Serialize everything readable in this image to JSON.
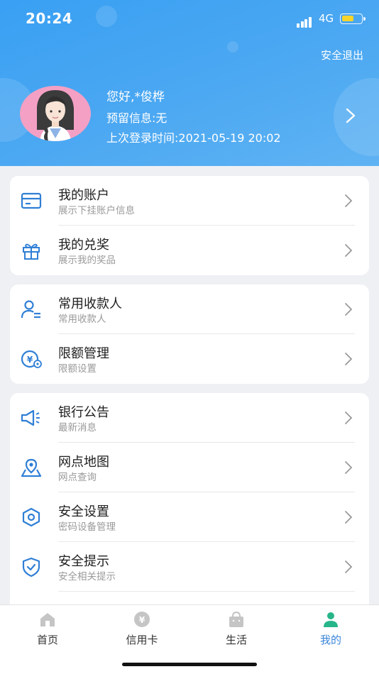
{
  "status_bar": {
    "time": "20:24",
    "network": "4G"
  },
  "header": {
    "logout": "安全退出",
    "greeting": "您好,*俊桦",
    "reserved_info": "预留信息:无",
    "last_login": "上次登录时间:2021-05-19 20:02"
  },
  "cards": [
    {
      "rows": [
        {
          "title": "我的账户",
          "sub": "展示下挂账户信息",
          "icon": "card-icon"
        },
        {
          "title": "我的兑奖",
          "sub": "展示我的奖品",
          "icon": "gift-icon"
        }
      ]
    },
    {
      "rows": [
        {
          "title": "常用收款人",
          "sub": "常用收款人",
          "icon": "payee-icon"
        },
        {
          "title": "限额管理",
          "sub": "限额设置",
          "icon": "limit-icon"
        }
      ]
    },
    {
      "rows": [
        {
          "title": "银行公告",
          "sub": "最新消息",
          "icon": "megaphone-icon"
        },
        {
          "title": "网点地图",
          "sub": "网点查询",
          "icon": "map-icon"
        },
        {
          "title": "安全设置",
          "sub": "密码设备管理",
          "icon": "security-settings-icon"
        },
        {
          "title": "安全提示",
          "sub": "安全相关提示",
          "icon": "shield-icon"
        }
      ]
    }
  ],
  "tabs": [
    {
      "label": "首页",
      "icon": "home-icon",
      "active": false
    },
    {
      "label": "信用卡",
      "icon": "credit-card-icon",
      "active": false
    },
    {
      "label": "生活",
      "icon": "life-icon",
      "active": false
    },
    {
      "label": "我的",
      "icon": "profile-icon",
      "active": true
    }
  ],
  "colors": {
    "header_blue": "#3fa2f3",
    "icon_blue": "#2f7fd6",
    "active_tab": "#3a86d9",
    "avatar_pink": "#f3a0c4"
  }
}
